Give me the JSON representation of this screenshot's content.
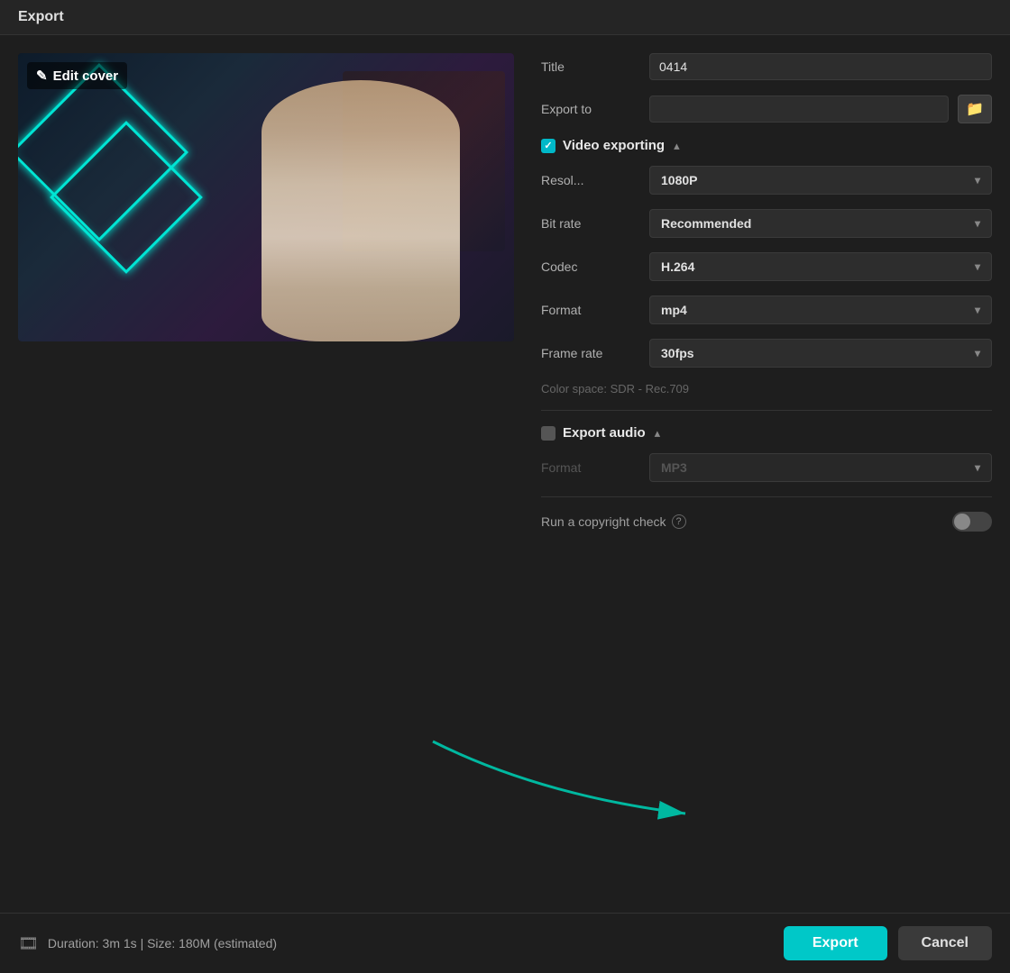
{
  "dialog": {
    "title": "Export",
    "titlebar": "Export"
  },
  "video": {
    "edit_cover_label": "Edit cover"
  },
  "form": {
    "title_label": "Title",
    "title_value": "0414",
    "export_to_label": "Export to",
    "export_to_value": "",
    "export_to_placeholder": ""
  },
  "video_exporting": {
    "section_label": "Video exporting",
    "resolution_label": "Resol...",
    "resolution_value": "1080P",
    "bitrate_label": "Bit rate",
    "bitrate_value": "Recommended",
    "codec_label": "Codec",
    "codec_value": "H.264",
    "format_label": "Format",
    "format_value": "mp4",
    "framerate_label": "Frame rate",
    "framerate_value": "30fps",
    "color_space": "Color space: SDR - Rec.709"
  },
  "audio_exporting": {
    "section_label": "Export audio",
    "format_label": "Format",
    "format_value": "MP3"
  },
  "copyright": {
    "label": "Run a copyright check",
    "enabled": false
  },
  "bottom_bar": {
    "duration_info": "Duration: 3m 1s | Size: 180M (estimated)",
    "export_btn": "Export",
    "cancel_btn": "Cancel"
  },
  "icons": {
    "pencil": "✎",
    "folder": "🗀",
    "checkmark": "✓",
    "chevron_down": "▾",
    "chevron_up": "▴",
    "film": "🎞"
  }
}
